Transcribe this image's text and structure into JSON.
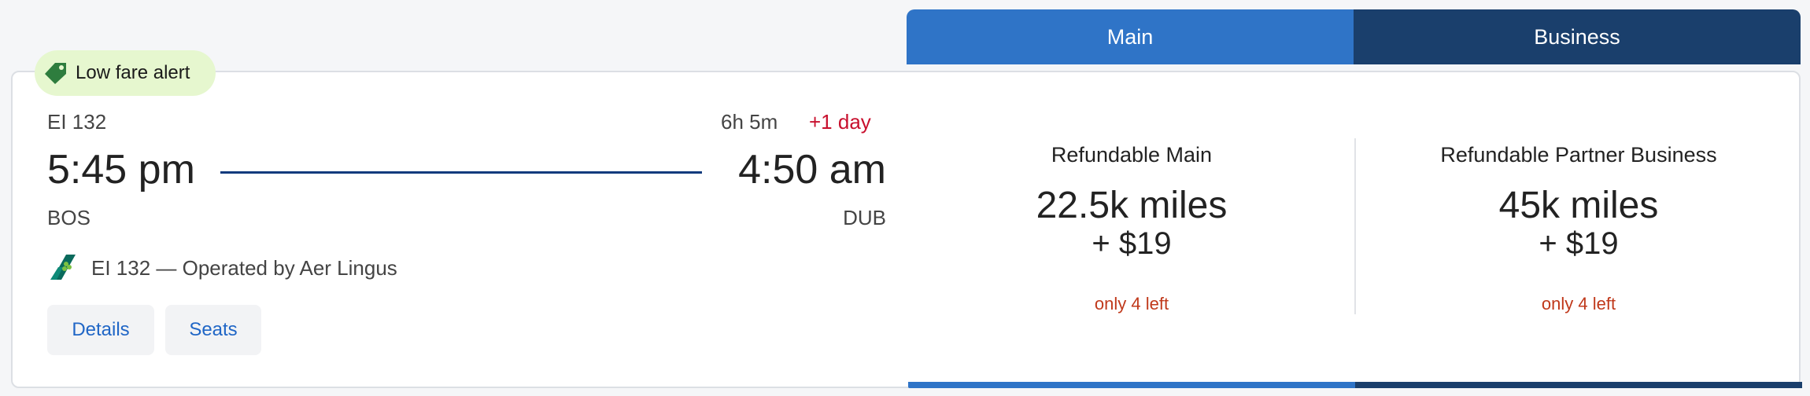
{
  "alert": {
    "label": "Low fare alert",
    "icon": "tag-icon",
    "color": "#e6f7cf"
  },
  "flight": {
    "number": "EI 132",
    "duration": "6h 5m",
    "day_offset": "+1 day",
    "depart_time": "5:45 pm",
    "arrive_time": "4:50 am",
    "origin": "BOS",
    "destination": "DUB",
    "operated_by": "EI 132 — Operated by Aer Lingus",
    "airline_icon": "aer-lingus-logo-icon"
  },
  "actions": {
    "details_label": "Details",
    "seats_label": "Seats"
  },
  "tabs": [
    {
      "label": "Main",
      "color": "#2f74c7"
    },
    {
      "label": "Business",
      "color": "#1a3f6c"
    }
  ],
  "fares": [
    {
      "name": "Refundable Main",
      "miles": "22.5k miles",
      "fee": "+ $19",
      "availability": "only 4 left"
    },
    {
      "name": "Refundable Partner Business",
      "miles": "45k miles",
      "fee": "+ $19",
      "availability": "only 4 left"
    }
  ],
  "colors": {
    "accent": "#2066c6",
    "route_line": "#0f3a7d",
    "warning": "#c8102e",
    "availability": "#c0391b"
  }
}
